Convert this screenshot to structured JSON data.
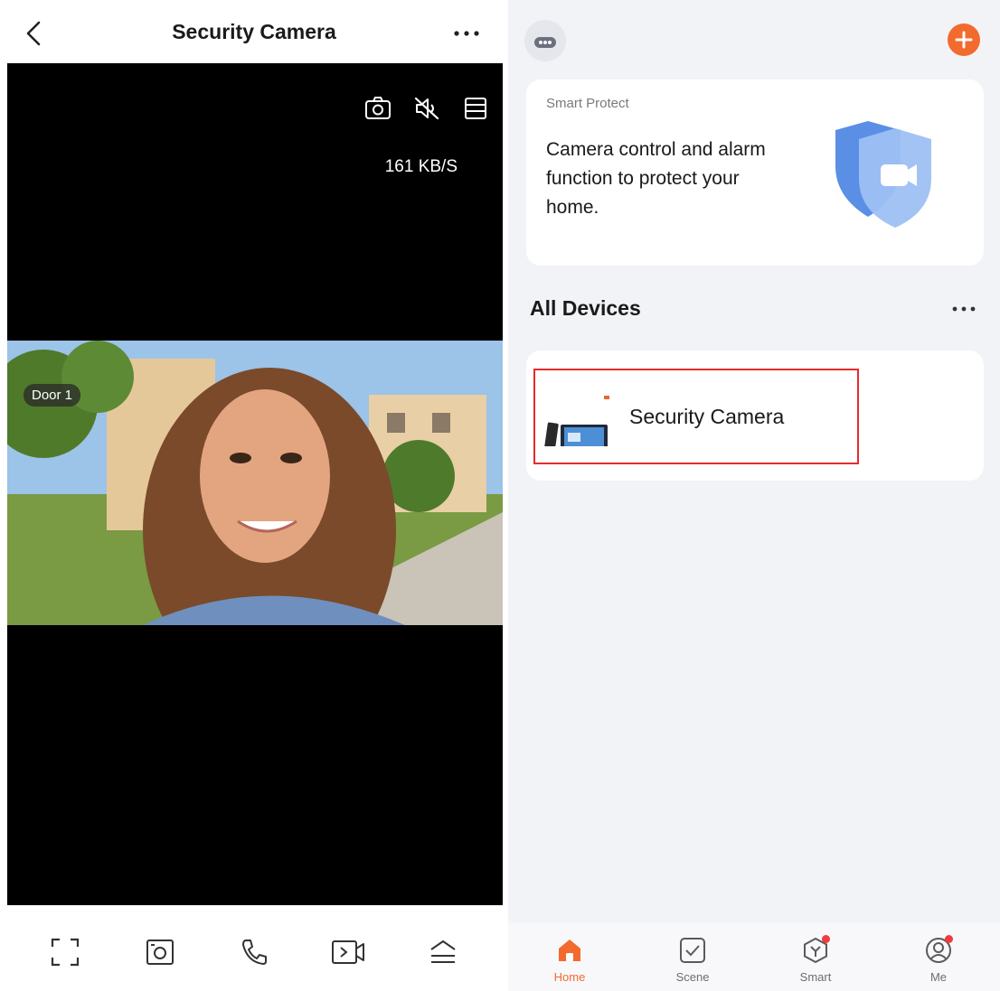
{
  "colors": {
    "accent": "#f26a2e",
    "highlight": "#e52b2b",
    "badge": "#f03c3c",
    "panel_bg": "#f2f3f7"
  },
  "left": {
    "title": "Security Camera",
    "back_icon": "chevron-left-icon",
    "more_icon": "more-horizontal-icon",
    "video": {
      "icons": [
        "snapshot-icon",
        "mute-icon",
        "layout-icon"
      ],
      "bitrate": "161 KB/S",
      "door_label": "Door 1"
    },
    "toolbar": [
      "fullscreen-icon",
      "screenshot-icon",
      "call-icon",
      "record-icon",
      "collapse-icon"
    ]
  },
  "right": {
    "avatar_icon": "home-avatar-icon",
    "add_icon": "plus-icon",
    "promo": {
      "subtitle": "Smart Protect",
      "text": "Camera control and alarm function to protect your home.",
      "image_icon": "shield-camera-icon"
    },
    "devices": {
      "title": "All Devices",
      "items": [
        {
          "name": "Security Camera",
          "icon": "door-camera-icon"
        }
      ]
    },
    "tabs": [
      {
        "label": "Home",
        "icon": "home-icon",
        "active": true,
        "badge": false
      },
      {
        "label": "Scene",
        "icon": "scene-check-icon",
        "active": false,
        "badge": false
      },
      {
        "label": "Smart",
        "icon": "smart-cube-icon",
        "active": false,
        "badge": true
      },
      {
        "label": "Me",
        "icon": "profile-icon",
        "active": false,
        "badge": true
      }
    ]
  }
}
